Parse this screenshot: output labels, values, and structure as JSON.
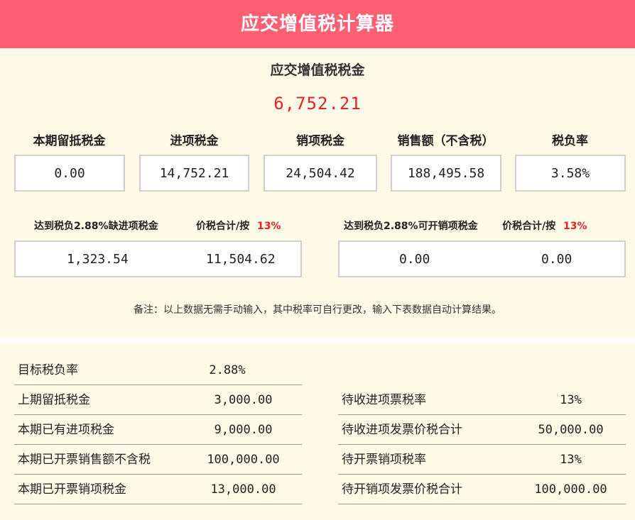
{
  "header": {
    "title": "应交增值税计算器"
  },
  "summary": {
    "title": "应交增值税税金",
    "total": "6,752.21"
  },
  "metrics": [
    {
      "label": "本期留抵税金",
      "value": "0.00"
    },
    {
      "label": "进项税金",
      "value": "14,752.21"
    },
    {
      "label": "销项税金",
      "value": "24,504.42"
    },
    {
      "label": "销售额（不含税）",
      "value": "188,495.58"
    },
    {
      "label": "税负率",
      "value": "3.58%"
    }
  ],
  "shortfall_left": {
    "label": "达到税负2.88%缺进项税金",
    "price_label": "价税合计/按",
    "rate": "13%",
    "value1": "1,323.54",
    "value2": "11,504.62"
  },
  "shortfall_right": {
    "label": "达到税负2.88%可开销项税金",
    "price_label": "价税合计/按",
    "rate": "13%",
    "value1": "0.00",
    "value2": "0.00"
  },
  "note": "备注：以上数据无需手动输入，其中税率可自行更改，输入下表数据自动计算结果。",
  "inputs_left": [
    {
      "label": "目标税负率",
      "value": "2.88%"
    },
    {
      "label": "上期留抵税金",
      "value": "3,000.00"
    },
    {
      "label": "本期已有进项税金",
      "value": "9,000.00"
    },
    {
      "label": "本期已开票销售额不含税",
      "value": "100,000.00"
    },
    {
      "label": "本期已开票销项税金",
      "value": "13,000.00"
    }
  ],
  "inputs_right": [
    {
      "label": "待收进项票税率",
      "value": "13%"
    },
    {
      "label": "待收进项发票价税合计",
      "value": "50,000.00"
    },
    {
      "label": "待开票销项税率",
      "value": "13%"
    },
    {
      "label": "待开销项发票价税合计",
      "value": "100,000.00"
    }
  ],
  "colors": {
    "header": "#ff5f73",
    "panel": "#fdfae7",
    "accent_red": "#e8202b"
  }
}
